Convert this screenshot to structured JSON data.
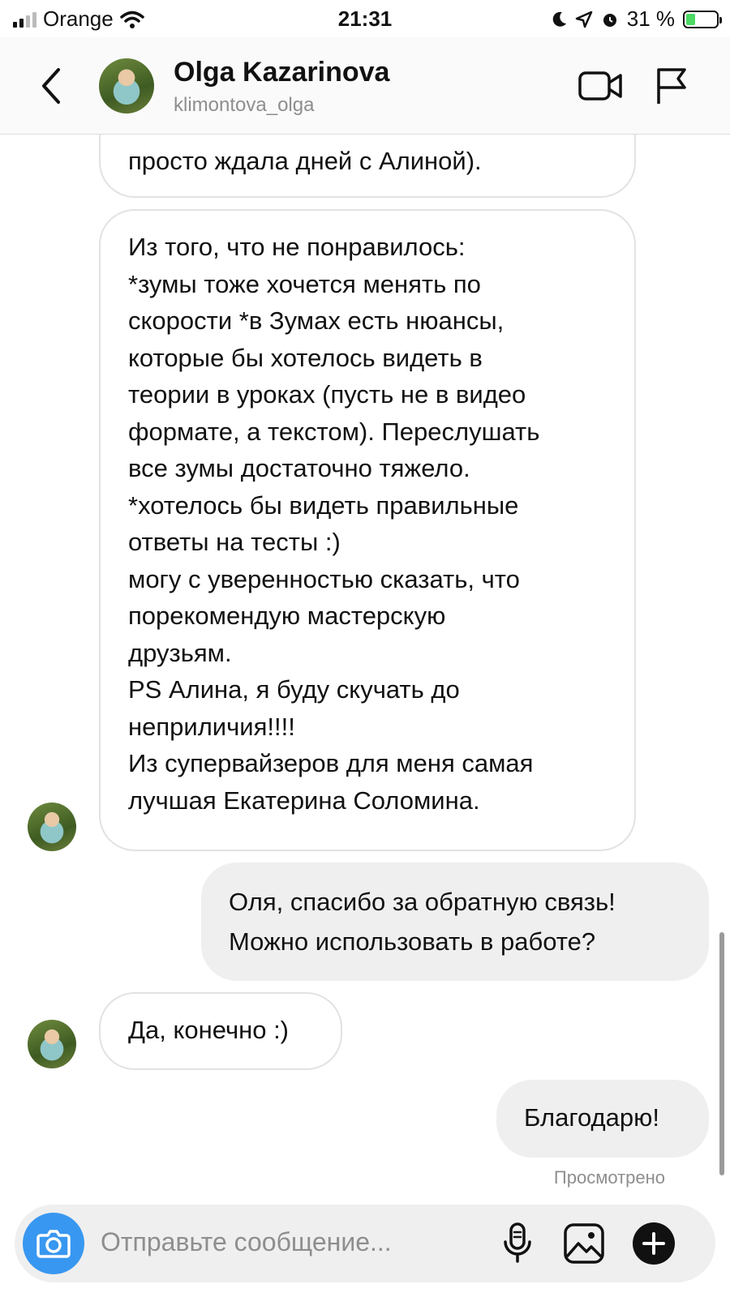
{
  "status_bar": {
    "carrier": "Orange",
    "time": "21:31",
    "battery": "31 %",
    "battery_level": 0.31
  },
  "header": {
    "name": "Olga Kazarinova",
    "username": "klimontova_olga"
  },
  "messages": [
    {
      "direction": "incoming",
      "text": "просто ждала дней с Алиной)."
    },
    {
      "direction": "incoming",
      "text": "Из того, что не понравилось:\n*зумы тоже хочется менять по\nскорости *в Зумах есть нюансы,\nкоторые бы хотелось видеть в\nтеории в уроках (пусть не в видео\nформате, а текстом). Переслушать\nвсе зумы достаточно тяжело.\n*хотелось бы видеть правильные\nответы на тесты :)\nмогу с уверенностью сказать, что\nпорекомендую мастерскую\nдрузьям.\nPS Алина, я буду скучать до\nнеприличия!!!!\nИз супервайзеров для меня самая\nлучшая Екатерина Соломина."
    },
    {
      "direction": "outgoing",
      "text": "Оля, спасибо за обратную связь!\nМожно использовать в работе?"
    },
    {
      "direction": "incoming",
      "text": "Да, конечно :)"
    },
    {
      "direction": "outgoing",
      "text": "Благодарю!"
    }
  ],
  "seen_label": "Просмотрено",
  "composer": {
    "placeholder": "Отправьте сообщение..."
  },
  "colors": {
    "accent": "#3897f0",
    "incoming_border": "#e2e2e2",
    "outgoing_bg": "#efefef",
    "battery_green": "#4cd964"
  },
  "icons": {
    "back": "chevron-left-icon",
    "video": "video-camera-icon",
    "report": "flag-icon",
    "camera": "camera-icon",
    "mic": "microphone-icon",
    "gallery": "image-icon",
    "more": "plus-icon"
  }
}
